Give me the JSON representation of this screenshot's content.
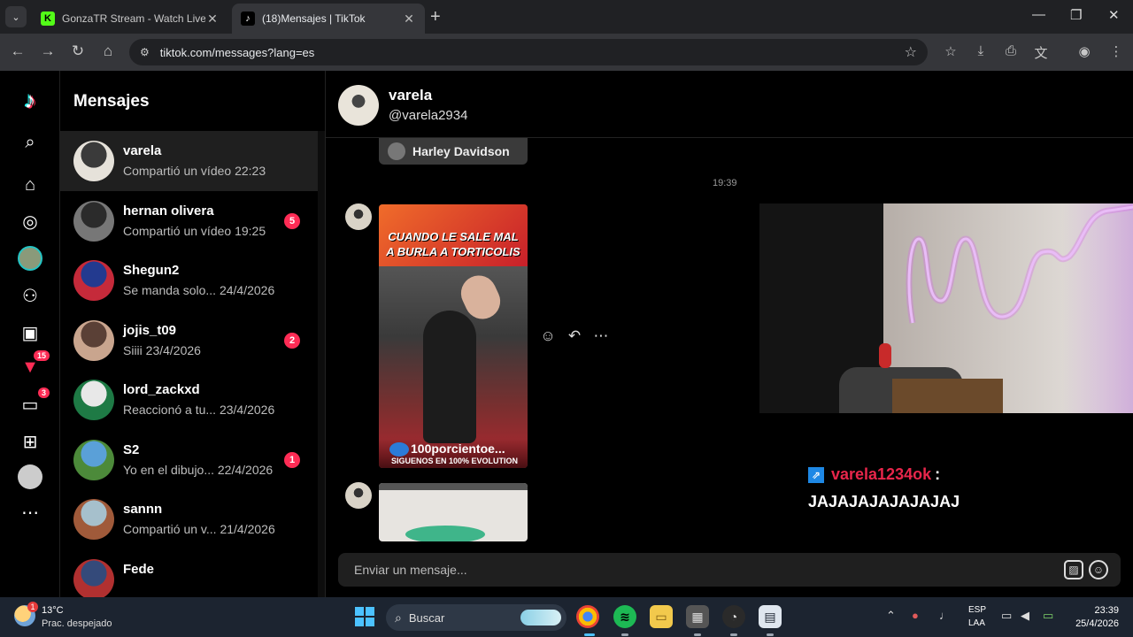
{
  "browser": {
    "tabs": [
      {
        "title": "GonzaTR Stream - Watch Live o",
        "favicon": "K"
      },
      {
        "title": "(18)Mensajes | TikTok",
        "favicon": "♪"
      }
    ],
    "url": "tiktok.com/messages?lang=es"
  },
  "rail": {
    "badges": {
      "activity": "15",
      "messages": "3"
    }
  },
  "inbox": {
    "title": "Mensajes",
    "conversations": [
      {
        "name": "varela",
        "preview": "Compartió un vídeo 22:23",
        "unread": "",
        "colors": [
          "#3a3a3a",
          "#e6e2da"
        ]
      },
      {
        "name": "hernan olivera",
        "preview": "Compartió un vídeo 19:25",
        "unread": "5",
        "colors": [
          "#2b2b2b",
          "#777"
        ]
      },
      {
        "name": "Shegun2",
        "preview": "Se manda solo... 24/4/2026",
        "unread": "",
        "colors": [
          "#233a8f",
          "#c52a3a"
        ]
      },
      {
        "name": "jojis_t09",
        "preview": "Siiii 23/4/2026",
        "unread": "2",
        "colors": [
          "#5a4036",
          "#c9a58e"
        ]
      },
      {
        "name": "lord_zackxd",
        "preview": "Reaccionó a tu... 23/4/2026",
        "unread": "",
        "colors": [
          "#e8e8e8",
          "#1e7a45"
        ]
      },
      {
        "name": "S2",
        "preview": "Yo en el dibujo... 22/4/2026",
        "unread": "1",
        "colors": [
          "#5aa0d8",
          "#4c8a3a"
        ]
      },
      {
        "name": "sannn",
        "preview": "Compartió un v... 21/4/2026",
        "unread": "",
        "colors": [
          "#a6c0cc",
          "#a05a3a"
        ]
      },
      {
        "name": "Fede",
        "preview": "",
        "unread": "",
        "colors": [
          "#344a7a",
          "#b13030"
        ]
      }
    ]
  },
  "chat": {
    "name": "varela",
    "handle": "@varela2934",
    "previous_card_label": "Harley Davidson",
    "timestamp": "19:39",
    "video": {
      "caption_line1": "CUANDO LE SALE MAL",
      "caption_line2": "A BURLA A TORTICOLIS",
      "channel": "100porcientoe...",
      "subtitle": "SIGUENOS EN 100% EVOLUTION"
    },
    "composer_placeholder": "Enviar un mensaje..."
  },
  "stream_overlay": {
    "username": "varela1234ok",
    "colon": ":",
    "message": "JAJAJAJAJAJAJAJ"
  },
  "taskbar": {
    "weather_temp": "13°C",
    "weather_desc": "Prac. despejado",
    "weather_badge": "1",
    "search_label": "Buscar",
    "lang_line1": "ESP",
    "lang_line2": "LAA",
    "time": "23:39",
    "date": "25/4/2026"
  }
}
